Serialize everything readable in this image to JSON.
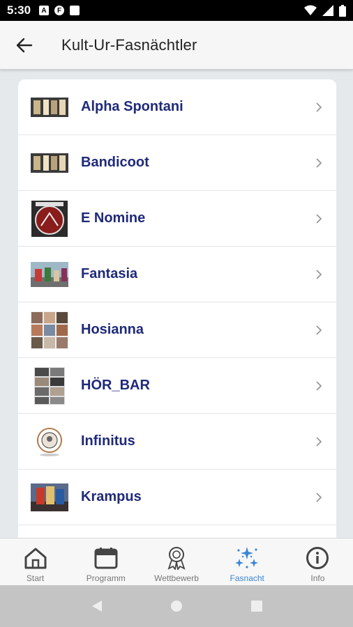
{
  "status": {
    "time": "5:30"
  },
  "header": {
    "title": "Kult-Ur-Fasnächtler"
  },
  "list": {
    "items": [
      {
        "label": "Alpha Spontani",
        "thumb": "group-photo-thumbnail"
      },
      {
        "label": "Bandicoot",
        "thumb": "group-photo-thumbnail"
      },
      {
        "label": "E Nomine",
        "thumb": "e-nomine-logo"
      },
      {
        "label": "Fantasia",
        "thumb": "parade-photo-thumbnail"
      },
      {
        "label": "Hosianna",
        "thumb": "collage-thumbnail"
      },
      {
        "label": "HÖR_BAR",
        "thumb": "collage-thumbnail"
      },
      {
        "label": "Infinitus",
        "thumb": "crest-logo"
      },
      {
        "label": "Krampus",
        "thumb": "costume-photo-thumbnail"
      }
    ]
  },
  "nav": {
    "items": [
      {
        "label": "Start",
        "icon": "home-icon"
      },
      {
        "label": "Programm",
        "icon": "calendar-icon"
      },
      {
        "label": "Wettbewerb",
        "icon": "award-icon"
      },
      {
        "label": "Fasnacht",
        "icon": "sparkle-icon"
      },
      {
        "label": "Info",
        "icon": "info-icon"
      }
    ],
    "active": "Fasnacht"
  },
  "colors": {
    "item_text": "#1f2a78",
    "active_nav": "#3a86d6"
  }
}
